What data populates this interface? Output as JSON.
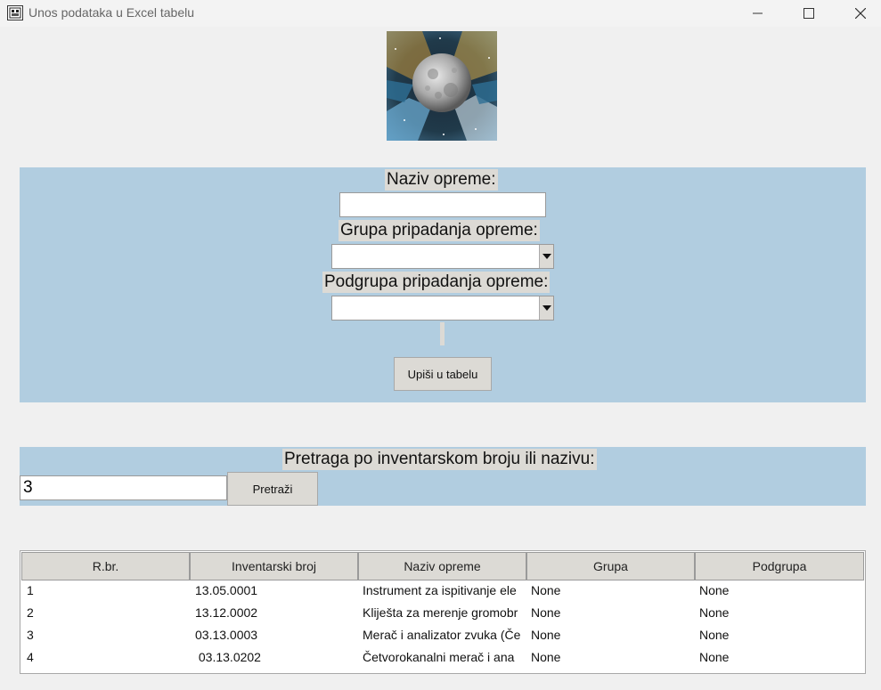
{
  "window": {
    "title": "Unos podataka u Excel tabelu",
    "icon": "app-window-icon",
    "controls": [
      "minimize-icon",
      "maximize-icon",
      "close-icon"
    ]
  },
  "logo": {
    "icon": "moon-image"
  },
  "form": {
    "naziv_label": "Naziv opreme:",
    "naziv_value": "",
    "grupa_label": "Grupa pripadanja opreme:",
    "grupa_value": "",
    "podgrupa_label": "Podgrupa pripadanja opreme:",
    "podgrupa_value": "",
    "submit_label": "Upiši u tabelu"
  },
  "search": {
    "label": "Pretraga po inventarskom broju ili nazivu:",
    "value": "3",
    "button_label": "Pretraži"
  },
  "table": {
    "columns": [
      "R.br.",
      "Inventarski broj",
      "Naziv opreme",
      "Grupa",
      "Podgrupa"
    ],
    "rows": [
      [
        "1",
        "13.05.0001",
        "Instrument za ispitivanje ele",
        "None",
        "None"
      ],
      [
        "2",
        "13.12.0002",
        "Kliješta za merenje gromobr",
        "None",
        "None"
      ],
      [
        "3",
        "03.13.0003",
        "Merač i analizator zvuka (Če",
        "None",
        "None"
      ],
      [
        "4",
        " 03.13.0202",
        "Četvorokanalni merač i ana",
        "None",
        "None"
      ]
    ]
  },
  "colors": {
    "panel": "#b1cde0",
    "background": "#f0f0f0",
    "widget": "#dcdad5"
  }
}
